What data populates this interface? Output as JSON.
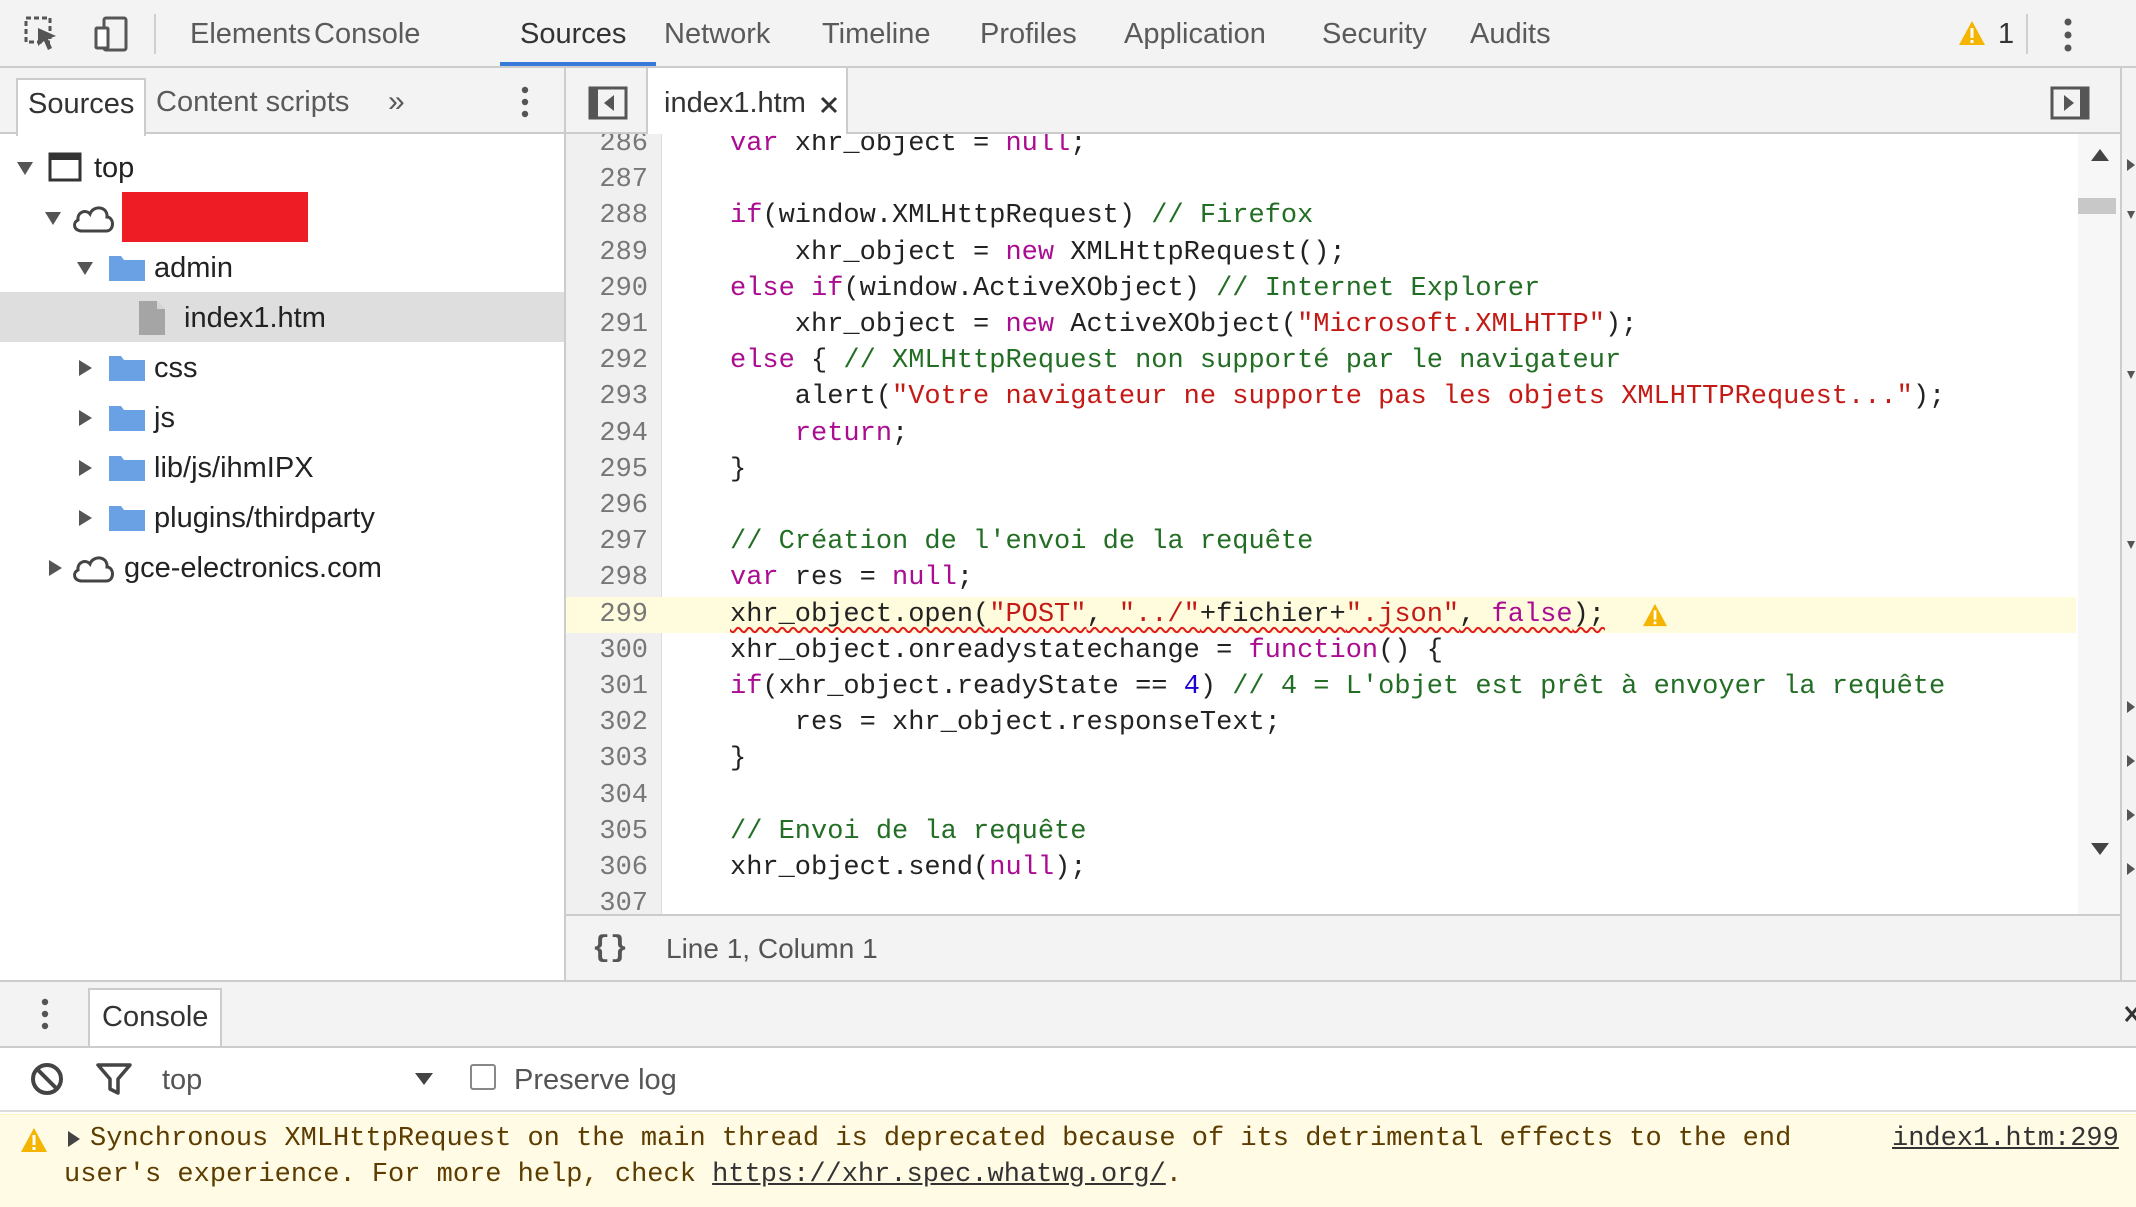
{
  "toolbar": {
    "tabs": [
      "Elements",
      "Console",
      "Sources",
      "Network",
      "Timeline",
      "Profiles",
      "Application",
      "Security",
      "Audits"
    ],
    "active_tab": "Sources",
    "warning_count": "1",
    "accent_color": "#3879d9",
    "warning_color": "#f4b400"
  },
  "navigator": {
    "tabs": {
      "sources": "Sources",
      "content_scripts": "Content scripts",
      "more": "»"
    },
    "tree": {
      "top": "top",
      "redacted_host": "",
      "admin": "admin",
      "file": "index1.htm",
      "css": "css",
      "js": "js",
      "lib": "lib/js/ihmIPX",
      "plugins": "plugins/thirdparty",
      "other_host": "gce-electronics.com"
    },
    "redaction_color": "#ee1c25",
    "folder_color": "#6aa1e4"
  },
  "editor": {
    "open_tab": "index1.htm",
    "highlighted_line": "299",
    "lines": [
      {
        "n": "286",
        "t": "    var xhr_object = null;"
      },
      {
        "n": "287",
        "t": ""
      },
      {
        "n": "288",
        "t": "    if(window.XMLHttpRequest) // Firefox"
      },
      {
        "n": "289",
        "t": "        xhr_object = new XMLHttpRequest();"
      },
      {
        "n": "290",
        "t": "    else if(window.ActiveXObject) // Internet Explorer"
      },
      {
        "n": "291",
        "t": "        xhr_object = new ActiveXObject(\"Microsoft.XMLHTTP\");"
      },
      {
        "n": "292",
        "t": "    else { // XMLHttpRequest non supporté par le navigateur"
      },
      {
        "n": "293",
        "t": "        alert(\"Votre navigateur ne supporte pas les objets XMLHTTPRequest...\");"
      },
      {
        "n": "294",
        "t": "        return;"
      },
      {
        "n": "295",
        "t": "    }"
      },
      {
        "n": "296",
        "t": ""
      },
      {
        "n": "297",
        "t": "    // Création de l'envoi de la requête"
      },
      {
        "n": "298",
        "t": "    var res = null;"
      },
      {
        "n": "299",
        "t": "    xhr_object.open(\"POST\", \"../\"+fichier+\".json\", false);"
      },
      {
        "n": "300",
        "t": "    xhr_object.onreadystatechange = function() {"
      },
      {
        "n": "301",
        "t": "    if(xhr_object.readyState == 4) // 4 = L'objet est prêt à envoyer la requête"
      },
      {
        "n": "302",
        "t": "        res = xhr_object.responseText;"
      },
      {
        "n": "303",
        "t": "    }"
      },
      {
        "n": "304",
        "t": ""
      },
      {
        "n": "305",
        "t": "    // Envoi de la requête"
      },
      {
        "n": "306",
        "t": "    xhr_object.send(null);"
      },
      {
        "n": "307",
        "t": ""
      }
    ],
    "status": {
      "pretty_print": "{}",
      "cursor": "Line 1, Column 1"
    }
  },
  "drawer": {
    "tab": "Console",
    "context": "top",
    "preserve_log_label": "Preserve log",
    "preserve_log_checked": false,
    "message": {
      "line1": "Synchronous XMLHttpRequest on the main thread is deprecated because of its detrimental effects to the end",
      "line2_prefix": "user's experience. For more help, check ",
      "link": "https://xhr.spec.whatwg.org/",
      "line2_suffix": ".",
      "source": "index1.htm:299"
    }
  }
}
